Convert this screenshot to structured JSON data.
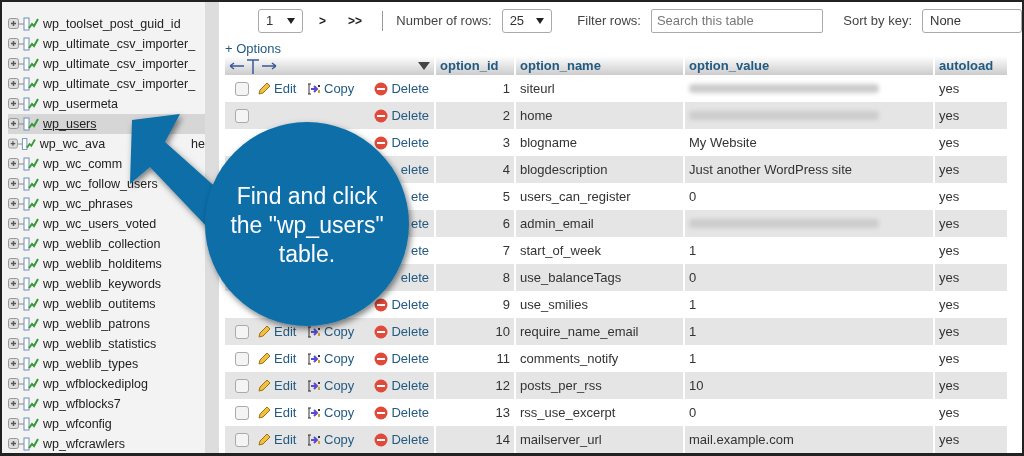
{
  "sidebar": {
    "items": [
      {
        "label": "wp_toolset_post_guid_id",
        "selected": false
      },
      {
        "label": "wp_ultimate_csv_importer_",
        "selected": false
      },
      {
        "label": "wp_ultimate_csv_importer_",
        "selected": false
      },
      {
        "label": "wp_ultimate_csv_importer_",
        "selected": false
      },
      {
        "label": "wp_usermeta",
        "selected": false
      },
      {
        "label": "wp_users",
        "selected": true
      },
      {
        "label": "wp_wc_ava",
        "tail": "he",
        "selected": false
      },
      {
        "label": "wp_wc_comm",
        "selected": false
      },
      {
        "label": "wp_wc_follow_users",
        "selected": false
      },
      {
        "label": "wp_wc_phrases",
        "selected": false
      },
      {
        "label": "wp_wc_users_voted",
        "selected": false
      },
      {
        "label": "wp_weblib_collection",
        "selected": false
      },
      {
        "label": "wp_weblib_holditems",
        "selected": false
      },
      {
        "label": "wp_weblib_keywords",
        "selected": false
      },
      {
        "label": "wp_weblib_outitems",
        "selected": false
      },
      {
        "label": "wp_weblib_patrons",
        "selected": false
      },
      {
        "label": "wp_weblib_statistics",
        "selected": false
      },
      {
        "label": "wp_weblib_types",
        "selected": false
      },
      {
        "label": "wp_wfblockediplog",
        "selected": false
      },
      {
        "label": "wp_wfblocks7",
        "selected": false
      },
      {
        "label": "wp_wfconfig",
        "selected": false
      },
      {
        "label": "wp_wfcrawlers",
        "selected": false
      }
    ]
  },
  "toolbar": {
    "page": "1",
    "next": ">",
    "last": ">>",
    "rows_label": "Number of rows:",
    "rows_value": "25",
    "filter_label": "Filter rows:",
    "filter_placeholder": "Search this table",
    "sort_label": "Sort by key:",
    "sort_value": "None"
  },
  "options_link": "+ Options",
  "table": {
    "columns": [
      "option_id",
      "option_name",
      "option_value",
      "autoload"
    ],
    "rows": [
      {
        "checked": false,
        "edit": "Edit",
        "copy": "Copy",
        "delete": "Delete",
        "id": "1",
        "name": "siteurl",
        "redacted": true,
        "autoload": "yes"
      },
      {
        "checked": false,
        "delete": "Delete",
        "id": "2",
        "name": "home",
        "redacted": true,
        "autoload": "yes"
      },
      {
        "delete": "Delete",
        "id": "3",
        "name": "blogname",
        "value": "My Website",
        "redacted": false,
        "autoload": "yes"
      },
      {
        "delete": "elete",
        "id": "4",
        "name": "blogdescription",
        "value": "Just another WordPress site",
        "redacted": false,
        "autoload": "yes"
      },
      {
        "delete": "ete",
        "id": "5",
        "name": "users_can_register",
        "value": "0",
        "redacted": false,
        "autoload": "yes"
      },
      {
        "delete": "ete",
        "id": "6",
        "name": "admin_email",
        "redacted": true,
        "autoload": "yes"
      },
      {
        "delete": "ete",
        "id": "7",
        "name": "start_of_week",
        "value": "1",
        "redacted": false,
        "autoload": "yes"
      },
      {
        "delete": "elete",
        "id": "8",
        "name": "use_balanceTags",
        "value": "0",
        "redacted": false,
        "autoload": "yes"
      },
      {
        "delete": "Delete",
        "id": "9",
        "name": "use_smilies",
        "value": "1",
        "redacted": false,
        "autoload": "yes"
      },
      {
        "checked": false,
        "edit": "Edit",
        "copy": "Copy",
        "delete": "Delete",
        "id": "10",
        "name": "require_name_email",
        "value": "1",
        "redacted": false,
        "autoload": "yes"
      },
      {
        "checked": false,
        "edit": "Edit",
        "copy": "Copy",
        "delete": "Delete",
        "id": "11",
        "name": "comments_notify",
        "value": "1",
        "redacted": false,
        "autoload": "yes"
      },
      {
        "checked": false,
        "edit": "Edit",
        "copy": "Copy",
        "delete": "Delete",
        "id": "12",
        "name": "posts_per_rss",
        "value": "10",
        "redacted": false,
        "autoload": "yes"
      },
      {
        "checked": false,
        "edit": "Edit",
        "copy": "Copy",
        "delete": "Delete",
        "id": "13",
        "name": "rss_use_excerpt",
        "value": "0",
        "redacted": false,
        "autoload": "yes"
      },
      {
        "checked": false,
        "edit": "Edit",
        "copy": "Copy",
        "delete": "Delete",
        "id": "14",
        "name": "mailserver_url",
        "value": "mail.example.com",
        "redacted": false,
        "autoload": "yes"
      }
    ]
  },
  "callout": {
    "text": "Find and click the \"wp_users\" table."
  }
}
